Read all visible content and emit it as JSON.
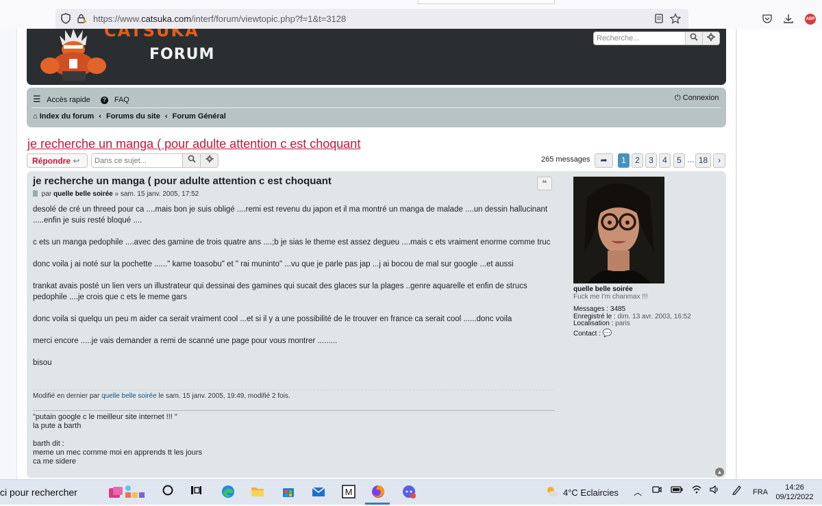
{
  "browser": {
    "url_prefix": "https://www.",
    "url_domain": "catsuka.com",
    "url_path": "/interf/forum/viewtopic.php?f=1&t=3128",
    "abp_label": "ABP"
  },
  "header": {
    "logo_top": "CATSUKA",
    "logo_bottom": "FORUM",
    "search_placeholder": "Recherche..."
  },
  "nav": {
    "quick_access": "Accès rapide",
    "faq": "FAQ",
    "login": "Connexion",
    "breadcrumb": [
      "Index du forum",
      "Forums du site",
      "Forum Général"
    ]
  },
  "topic": {
    "title": "je recherche un manga ( pour adulte attention c est choquant",
    "reply_label": "Répondre",
    "search_placeholder": "Dans ce sujet...",
    "message_count": "265 messages",
    "pages": [
      "1",
      "2",
      "3",
      "4",
      "5",
      "18"
    ],
    "ellipsis": "…"
  },
  "post": {
    "subject": "je recherche un manga ( pour adulte attention c est choquant",
    "by": "par",
    "author": "quelle belle soirée",
    "date": "» sam. 15 janv. 2005, 17:52",
    "paragraphs": [
      "desolé de cré un threed pour ca ....mais bon je suis obligé ....remi est revenu du japon et il ma montré un manga de malade ....un dessin hallucinant .....enfin je suis resté bloqué ....",
      "c ets un manga pedophile ....avec des gamine de trois quatre ans ....;b je sias le theme est assez degueu ....mais c ets vraiment enorme comme truc",
      "donc voila j ai noté sur la pochette ......\" kame toasobu\" et \" rai muninto\" ...vu que je parle pas jap ...j ai bocou de mal sur google ...et aussi",
      "trankat avais posté un lien vers un illustrateur qui dessinai des gamines qui sucait des glaces sur la plages ..genre aquarelle et enfin de strucs pedophile ....je crois que c ets le meme gars",
      "donc voila si quelqu un peu m aider ca serait vraiment cool ...et si il y a une possibilité de le trouver en france ca serait cool ......donc voila",
      "merci encore .....je vais demander a remi de scanné une page pour vous montrer .........",
      "bisou"
    ],
    "edited_prefix": "Modifié en dernier par",
    "edited_author": "quelle belle soirée",
    "edited_suffix": "le sam. 15 janv. 2005, 19:49, modifié 2 fois.",
    "signature": [
      "\"putain google c le meilleur site internet !!! \"",
      "la pute a barth",
      "",
      "barth dit :",
      "meme un mec comme moi en apprends tt les jours",
      "ca me sidere"
    ]
  },
  "profile": {
    "name": "quelle belle soirée",
    "rank": "Fuck me I'm chanmax !!!",
    "messages_label": "Messages :",
    "messages_value": "3485",
    "registered_label": "Enregistré le :",
    "registered_value": "dim. 13 avr. 2003, 16:52",
    "location_label": "Localisation :",
    "location_value": "paris",
    "contact_label": "Contact :"
  },
  "taskbar": {
    "search_text": "ci pour rechercher",
    "weather": "4°C  Eclaircies",
    "lang": "FRA",
    "time": "14:26",
    "date": "09/12/2022"
  }
}
